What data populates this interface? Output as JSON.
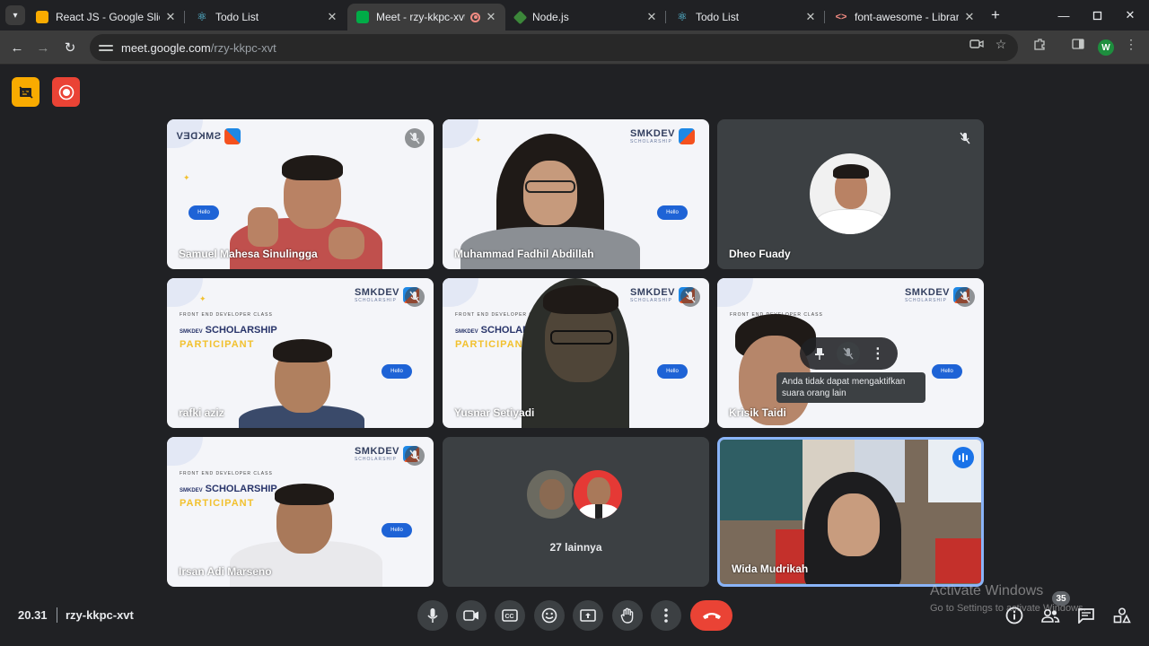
{
  "browser": {
    "tabs": [
      {
        "label": "React JS - Google Slide",
        "icon": "slides-icon",
        "color": "#f9ab00"
      },
      {
        "label": "Todo List",
        "icon": "react-icon",
        "color": "#61dafb"
      },
      {
        "label": "Meet - rzy-kkpc-xvt",
        "icon": "meet-icon",
        "color": "#00ac47"
      },
      {
        "label": "Node.js",
        "icon": "node-icon",
        "color": "#3c873a"
      },
      {
        "label": "Todo List",
        "icon": "react-icon",
        "color": "#61dafb"
      },
      {
        "label": "font-awesome - Libraries",
        "icon": "code-icon",
        "color": "#f28b82"
      }
    ],
    "url_host": "meet.google.com",
    "url_path": "/rzy-kkpc-xvt",
    "profile_initial": "W"
  },
  "tiles": [
    {
      "name": "Samuel Mahesa Sinulingga"
    },
    {
      "name": "Muhammad Fadhil Abdillah"
    },
    {
      "name": "Dheo Fuady"
    },
    {
      "name": "rafki aziz"
    },
    {
      "name": "Yusnar Setiyadi"
    },
    {
      "name": "Krisik Taidi"
    },
    {
      "name": "Irsan Adi Marseno"
    },
    {
      "name": "27 lainnya"
    },
    {
      "name": "Wida Mudrikah"
    }
  ],
  "slide": {
    "logo": "SMKDEV",
    "logo_sub": "SCHOLARSHIP",
    "class_text": "FRONT END DEVELOPER CLASS",
    "pre": "SMKDEV",
    "title": "SCHOLARSHIP",
    "subtitle": "PARTICIPANT",
    "hello": "Hello"
  },
  "tooltip": "Anda tidak dapat mengaktifkan suara orang lain",
  "bottom": {
    "time": "20.31",
    "meeting_code": "rzy-kkpc-xvt",
    "participant_count": "35"
  },
  "watermark": {
    "line1": "Activate Windows",
    "line2": "Go to Settings to activate Windows."
  },
  "colors": {
    "end_call": "#ea4335",
    "active_speaker": "#8ab4f8",
    "background": "#202124"
  }
}
